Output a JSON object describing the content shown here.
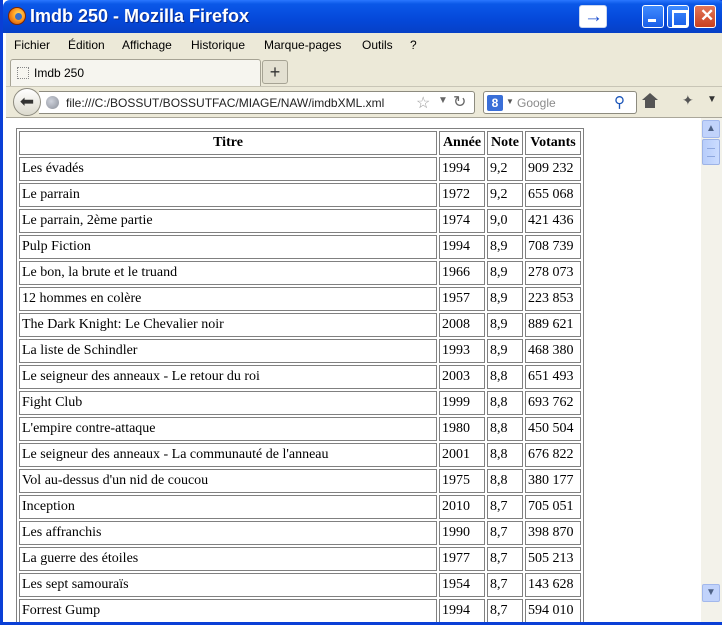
{
  "window": {
    "title": "Imdb 250"
  },
  "titlebar": {
    "text": "Imdb 250 - Mozilla Firefox"
  },
  "menu": {
    "fichier": "Fichier",
    "edition": "Édition",
    "affichage": "Affichage",
    "historique": "Historique",
    "marque_pages": "Marque-pages",
    "outils": "Outils",
    "aide": "?"
  },
  "tabs": [
    {
      "label": "Imdb 250"
    }
  ],
  "navbar": {
    "url": "file:///C:/BOSSUT/BOSSUTFAC/MIAGE/NAW/imdbXML.xml",
    "search_placeholder": "Google"
  },
  "icons": {
    "back": "back-arrow-icon",
    "globe": "globe-icon",
    "bookmark": "star-icon",
    "reload": "reload-icon",
    "search_engine": "google-icon",
    "search": "magnifier-icon",
    "home": "home-icon",
    "addon": "addon-icon"
  },
  "table": {
    "headers": {
      "title": "Titre",
      "year": "Année",
      "note": "Note",
      "votes": "Votants"
    },
    "rows": [
      {
        "title": "Les évadés",
        "year": "1994",
        "note": "9,2",
        "votes": "909 232"
      },
      {
        "title": "Le parrain",
        "year": "1972",
        "note": "9,2",
        "votes": "655 068"
      },
      {
        "title": "Le parrain, 2ème partie",
        "year": "1974",
        "note": "9,0",
        "votes": "421 436"
      },
      {
        "title": "Pulp Fiction",
        "year": "1994",
        "note": "8,9",
        "votes": "708 739"
      },
      {
        "title": "Le bon, la brute et le truand",
        "year": "1966",
        "note": "8,9",
        "votes": "278 073"
      },
      {
        "title": "12 hommes en colère",
        "year": "1957",
        "note": "8,9",
        "votes": "223 853"
      },
      {
        "title": "The Dark Knight: Le Chevalier noir",
        "year": "2008",
        "note": "8,9",
        "votes": "889 621"
      },
      {
        "title": "La liste de Schindler",
        "year": "1993",
        "note": "8,9",
        "votes": "468 380"
      },
      {
        "title": "Le seigneur des anneaux - Le retour du roi",
        "year": "2003",
        "note": "8,8",
        "votes": "651 493"
      },
      {
        "title": "Fight Club",
        "year": "1999",
        "note": "8,8",
        "votes": "693 762"
      },
      {
        "title": "L'empire contre-attaque",
        "year": "1980",
        "note": "8,8",
        "votes": "450 504"
      },
      {
        "title": "Le seigneur des anneaux - La communauté de l'anneau",
        "year": "2001",
        "note": "8,8",
        "votes": "676 822"
      },
      {
        "title": "Vol au-dessus d'un nid de coucou",
        "year": "1975",
        "note": "8,8",
        "votes": "380 177"
      },
      {
        "title": "Inception",
        "year": "2010",
        "note": "8,7",
        "votes": "705 051"
      },
      {
        "title": "Les affranchis",
        "year": "1990",
        "note": "8,7",
        "votes": "398 870"
      },
      {
        "title": "La guerre des étoiles",
        "year": "1977",
        "note": "8,7",
        "votes": "505 213"
      },
      {
        "title": "Les sept samouraïs",
        "year": "1954",
        "note": "8,7",
        "votes": "143 628"
      },
      {
        "title": "Forrest Gump",
        "year": "1994",
        "note": "8,7",
        "votes": "594 010"
      }
    ]
  }
}
